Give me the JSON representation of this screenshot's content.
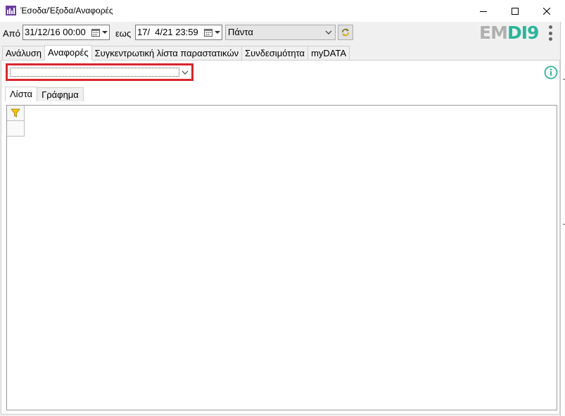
{
  "window": {
    "title": "Έσοδα/Έξοδα/Αναφορές",
    "controls": [
      "minimize",
      "maximize",
      "close"
    ]
  },
  "date_filter": {
    "from_label": "Από",
    "from_value": "31/12/16 00:00",
    "to_label": "εως",
    "to_value": "17/  4/21 23:59",
    "period_value": "Πάντα"
  },
  "logo": {
    "part1": "EM",
    "part2": "DI",
    "part3": "9"
  },
  "tabs": [
    {
      "label": "Ανάλυση",
      "active": false
    },
    {
      "label": "Αναφορές",
      "active": true
    },
    {
      "label": "Συγκεντρωτική λίστα παραστατικών",
      "active": false
    },
    {
      "label": "Συνδεσιμότητα",
      "active": false
    },
    {
      "label": "myDATA",
      "active": false
    }
  ],
  "report_selector": {
    "value": ""
  },
  "subtabs": [
    {
      "label": "Λίστα",
      "active": true
    },
    {
      "label": "Γράφημα",
      "active": false
    }
  ],
  "colors": {
    "accent_red": "#d9272e",
    "logo_green": "#2bb59a",
    "logo_gray": "#b0b0b0"
  },
  "icons": {
    "app": "app-icon",
    "calendar": "calendar-icon",
    "refresh": "refresh-icon",
    "info": "info-icon",
    "filter": "filter-icon",
    "kebab": "more-vertical-icon"
  }
}
